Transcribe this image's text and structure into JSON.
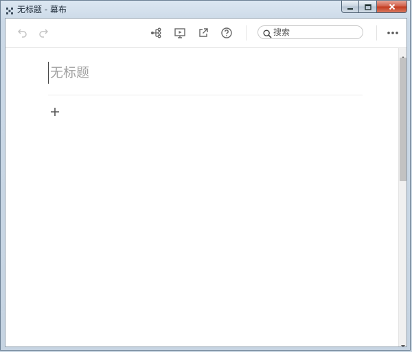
{
  "window": {
    "title": "无标题 - 幕布",
    "app_icon": "mubu-app-icon",
    "controls": [
      "minimize-icon",
      "maximize-icon",
      "close-icon"
    ]
  },
  "toolbar": {
    "undo_icon": "undo-icon",
    "redo_icon": "redo-icon",
    "mindmap_icon": "mindmap-icon",
    "presentation_icon": "presentation-icon",
    "export_icon": "export-icon",
    "help_icon": "help-icon",
    "search": {
      "placeholder": "搜索",
      "value": ""
    },
    "more_icon": "more-icon"
  },
  "document": {
    "title_placeholder": "无标题",
    "title_value": "",
    "add_icon": "plus-icon"
  },
  "colors": {
    "accent_close": "#c2391d",
    "icon_gray": "#666666",
    "disabled_icon": "#c4c4c4",
    "placeholder_text": "#a0a0a0"
  }
}
